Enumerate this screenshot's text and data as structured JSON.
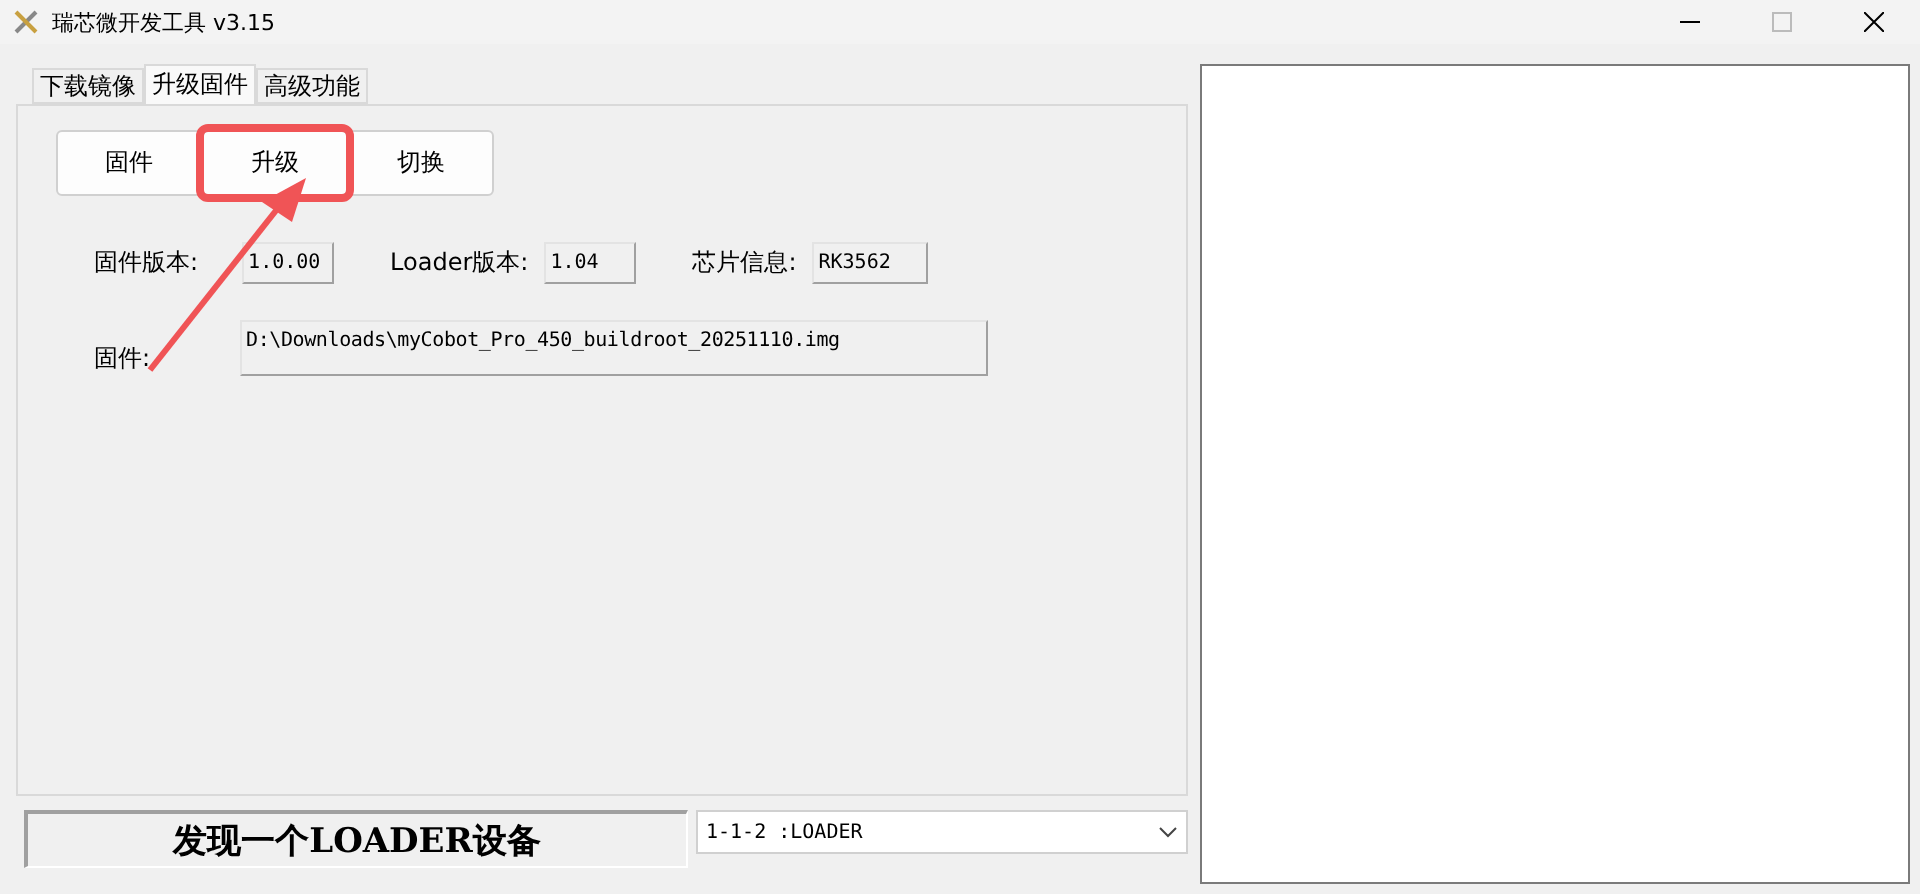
{
  "window": {
    "title": "瑞芯微开发工具 v3.15"
  },
  "tabs": [
    {
      "label": "下载镜像",
      "selected": false
    },
    {
      "label": "升级固件",
      "selected": true
    },
    {
      "label": "高级功能",
      "selected": false
    }
  ],
  "buttons": [
    {
      "label": "固件",
      "highlighted": false
    },
    {
      "label": "升级",
      "highlighted": true
    },
    {
      "label": "切换",
      "highlighted": false
    }
  ],
  "info_fields": [
    {
      "label": "固件版本:",
      "value": "1.0.00"
    },
    {
      "label": "Loader版本:",
      "value": "1.04"
    },
    {
      "label": "芯片信息:",
      "value": "RK3562"
    }
  ],
  "firmware": {
    "label": "固件:",
    "value": "D:\\Downloads\\myCobot_Pro_450_buildroot_20251110.img"
  },
  "status": "发现一个LOADER设备",
  "device_select": {
    "value": "1-1-2 :LOADER"
  }
}
